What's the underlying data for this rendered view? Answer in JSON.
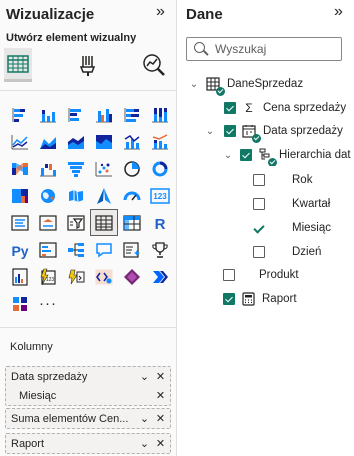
{
  "viz": {
    "title": "Wizualizacje",
    "collapse_glyph": "»",
    "build_label": "Utwórz element wizualny",
    "build_tabs": [
      {
        "name": "add-visual-tab",
        "icon": "table-grid-icon",
        "selected": true
      },
      {
        "name": "format-tab",
        "icon": "paint-brush-icon",
        "selected": false
      },
      {
        "name": "analytics-tab",
        "icon": "magnifier-chart-icon",
        "selected": false
      }
    ],
    "visuals": [
      "stacked-bar-chart-icon",
      "stacked-column-chart-icon",
      "clustered-bar-chart-icon",
      "clustered-column-chart-icon",
      "100pct-bar-chart-icon",
      "100pct-column-chart-icon",
      "line-chart-icon",
      "area-chart-icon",
      "stacked-area-chart-icon",
      "100pct-area-chart-icon",
      "line-column-chart-icon",
      "line-stacked-column-icon",
      "ribbon-chart-icon",
      "waterfall-chart-icon",
      "funnel-chart-icon",
      "scatter-chart-icon",
      "pie-chart-icon",
      "donut-chart-icon",
      "treemap-icon",
      "map-icon",
      "filled-map-icon",
      "azure-map-icon",
      "gauge-icon",
      "card-icon",
      "multirow-card-icon",
      "kpi-icon",
      "slicer-icon",
      "table-icon",
      "matrix-icon",
      "r-visual-icon",
      "python-visual-icon",
      "key-influencers-icon",
      "decomposition-tree-icon",
      "qa-icon",
      "smart-narrative-icon",
      "trophy-icon",
      "paginated-report-icon",
      "metrics-icon",
      "power-apps-icon",
      "power-automate-icon",
      "powerapps-diamond-icon",
      "chevron-arrows-icon",
      "get-more-visuals-icon",
      "more-options-icon"
    ],
    "more_glyph": "···",
    "well_label": "Kolumny",
    "fields": [
      {
        "label": "Data sprzedaży",
        "sub": "Miesiąc"
      },
      {
        "label": "Suma elementów Cen..."
      },
      {
        "label": "Raport"
      }
    ]
  },
  "data": {
    "title": "Dane",
    "collapse_glyph": "»",
    "search_placeholder": "Wyszukaj",
    "tree": [
      {
        "label": "DaneSprzedaz",
        "type": "table",
        "chevron": "down",
        "checkbox": false,
        "badge": true
      },
      {
        "label": "Cena sprzedaży",
        "type": "sum",
        "checkbox": "checked"
      },
      {
        "label": "Data sprzedaży",
        "type": "date-table",
        "chevron": "down",
        "checkbox": "checked",
        "badge": true
      },
      {
        "label": "Hierarchia dat",
        "type": "hierarchy",
        "chevron": "down",
        "checkbox": "checked",
        "badge": true
      },
      {
        "label": "Rok",
        "checkbox": "unchecked"
      },
      {
        "label": "Kwartał",
        "checkbox": "unchecked"
      },
      {
        "label": "Miesiąc",
        "checkbox": "check-only"
      },
      {
        "label": "Dzień",
        "checkbox": "unchecked"
      },
      {
        "label": "Produkt",
        "checkbox": "unchecked"
      },
      {
        "label": "Raport",
        "type": "calculator",
        "checkbox": "checked"
      }
    ]
  },
  "colors": {
    "accent": "#117865",
    "blue": "#118dff",
    "navy": "#12239e",
    "orange": "#e66c37",
    "gold": "#f2c80f",
    "purple": "#6b007b"
  }
}
